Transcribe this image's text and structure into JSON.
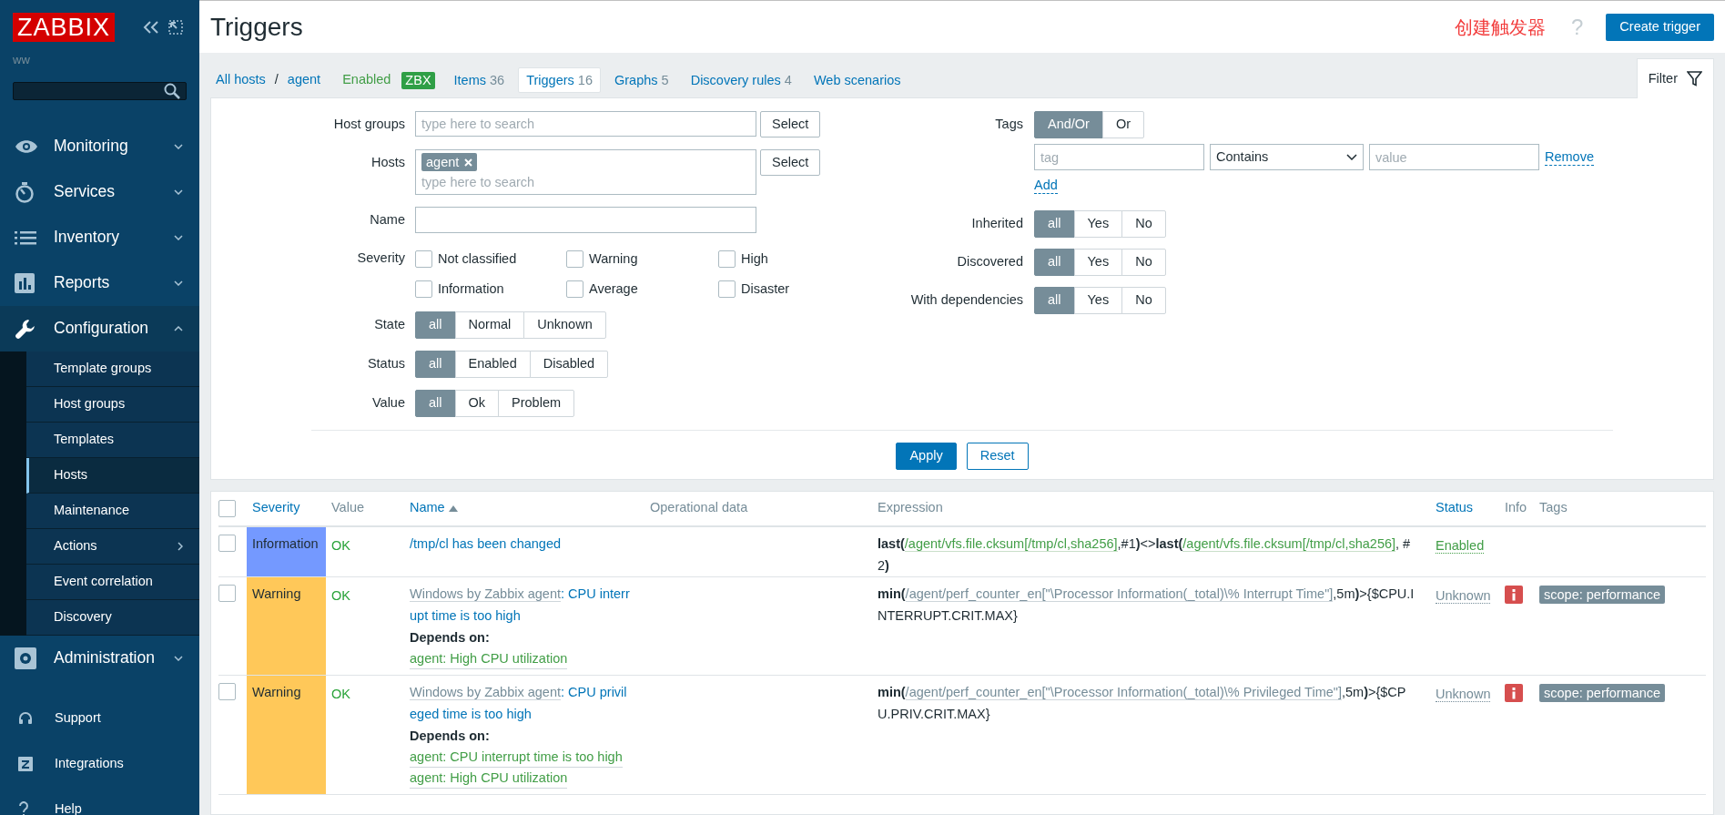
{
  "sidebar": {
    "logo": "ZABBIX",
    "user": "ww",
    "menu": [
      {
        "label": "Monitoring",
        "kind": "eye",
        "selected": false,
        "expanded": false
      },
      {
        "label": "Services",
        "kind": "timer",
        "selected": false,
        "expanded": false
      },
      {
        "label": "Inventory",
        "kind": "list",
        "selected": false,
        "expanded": false
      },
      {
        "label": "Reports",
        "kind": "chart",
        "selected": false,
        "expanded": false
      },
      {
        "label": "Configuration",
        "kind": "wrench",
        "selected": true,
        "expanded": true,
        "children": [
          {
            "label": "Template groups",
            "selected": false,
            "submenu": false
          },
          {
            "label": "Host groups",
            "selected": false,
            "submenu": false
          },
          {
            "label": "Templates",
            "selected": false,
            "submenu": false
          },
          {
            "label": "Hosts",
            "selected": true,
            "submenu": false
          },
          {
            "label": "Maintenance",
            "selected": false,
            "submenu": false
          },
          {
            "label": "Actions",
            "selected": false,
            "submenu": true
          },
          {
            "label": "Event correlation",
            "selected": false,
            "submenu": false
          },
          {
            "label": "Discovery",
            "selected": false,
            "submenu": false
          }
        ]
      },
      {
        "label": "Administration",
        "kind": "gear",
        "selected": false,
        "expanded": false
      }
    ],
    "footer": [
      {
        "label": "Support",
        "kind": "headset"
      },
      {
        "label": "Integrations",
        "kind": "z"
      },
      {
        "label": "Help",
        "kind": "question"
      }
    ]
  },
  "header": {
    "title": "Triggers",
    "annotation": "创建触发器",
    "help": "?",
    "create_button": "Create trigger"
  },
  "nav": {
    "breadcrumbs": [
      "All hosts",
      "agent"
    ],
    "separator": "/",
    "status": "Enabled",
    "badge": "ZBX",
    "tabs": [
      {
        "label": "Items",
        "count": "36",
        "selected": false
      },
      {
        "label": "Triggers",
        "count": "16",
        "selected": true
      },
      {
        "label": "Graphs",
        "count": "5",
        "selected": false
      },
      {
        "label": "Discovery rules",
        "count": "4",
        "selected": false
      },
      {
        "label": "Web scenarios",
        "selected": false
      }
    ],
    "filter_tab": "Filter"
  },
  "filter": {
    "left": [
      {
        "kind": "multiselect",
        "label": "Host groups",
        "placeholder": "type here to search",
        "button": "Select"
      },
      {
        "kind": "multiselect",
        "label": "Hosts",
        "chips": [
          "agent"
        ],
        "placeholder": "type here to search",
        "button": "Select"
      },
      {
        "kind": "text",
        "label": "Name"
      },
      {
        "kind": "checks",
        "label": "Severity",
        "options": [
          {
            "label": "Not classified",
            "checked": false
          },
          {
            "label": "Warning",
            "checked": false
          },
          {
            "label": "High",
            "checked": false
          },
          {
            "label": "Information",
            "checked": false
          },
          {
            "label": "Average",
            "checked": false
          },
          {
            "label": "Disaster",
            "checked": false
          }
        ]
      },
      {
        "kind": "segmented",
        "label": "State",
        "options": [
          {
            "label": "all",
            "selected": true
          },
          {
            "label": "Normal",
            "selected": false
          },
          {
            "label": "Unknown",
            "selected": false
          }
        ]
      },
      {
        "kind": "segmented",
        "label": "Status",
        "options": [
          {
            "label": "all",
            "selected": true
          },
          {
            "label": "Enabled",
            "selected": false
          },
          {
            "label": "Disabled",
            "selected": false
          }
        ]
      },
      {
        "kind": "segmented",
        "label": "Value",
        "options": [
          {
            "label": "all",
            "selected": true
          },
          {
            "label": "Ok",
            "selected": false
          },
          {
            "label": "Problem",
            "selected": false
          }
        ]
      }
    ],
    "tags": {
      "label": "Tags",
      "options": [
        {
          "label": "And/Or",
          "selected": true
        },
        {
          "label": "Or",
          "selected": false
        }
      ],
      "tag_placeholder": "tag",
      "operator": "Contains",
      "value_placeholder": "value",
      "remove": "Remove",
      "add": "Add"
    },
    "right": [
      {
        "label": "Inherited",
        "options": [
          {
            "label": "all",
            "selected": true
          },
          {
            "label": "Yes",
            "selected": false
          },
          {
            "label": "No",
            "selected": false
          }
        ]
      },
      {
        "label": "Discovered",
        "options": [
          {
            "label": "all",
            "selected": true
          },
          {
            "label": "Yes",
            "selected": false
          },
          {
            "label": "No",
            "selected": false
          }
        ]
      },
      {
        "label": "With dependencies",
        "options": [
          {
            "label": "all",
            "selected": true
          },
          {
            "label": "Yes",
            "selected": false
          },
          {
            "label": "No",
            "selected": false
          }
        ]
      }
    ],
    "apply": "Apply",
    "reset": "Reset"
  },
  "table": {
    "all_checked": false,
    "columns": [
      {
        "label": "Severity",
        "sortable": true,
        "sorted": false
      },
      {
        "label": "Value",
        "sortable": false,
        "sorted": false
      },
      {
        "label": "Name",
        "sortable": true,
        "sorted": true
      },
      {
        "label": "Operational data",
        "sortable": false,
        "sorted": false
      },
      {
        "label": "Expression",
        "sortable": false,
        "sorted": false
      },
      {
        "label": "Status",
        "sortable": true,
        "sorted": false
      },
      {
        "label": "Info",
        "sortable": false,
        "sorted": false
      },
      {
        "label": "Tags",
        "sortable": false,
        "sorted": false
      }
    ],
    "template_separator": ":",
    "rows": [
      {
        "checked": false,
        "severity": "Information",
        "color": "#7499ff",
        "value": "OK",
        "name": "/tmp/cl has been changed",
        "depends": [],
        "expression": [
          {
            "kind": "func",
            "text": "last("
          },
          {
            "kind": "item",
            "text": "/agent/vfs.file.cksum[/tmp/cl,sha256]",
            "active": true
          },
          {
            "kind": "text",
            "text": ",#1"
          },
          {
            "kind": "func",
            "text": ")"
          },
          {
            "kind": "text",
            "text": "<>"
          },
          {
            "kind": "func",
            "text": "last("
          },
          {
            "kind": "item",
            "text": "/agent/vfs.file.cksum[/tmp/cl,sha256]",
            "active": true
          },
          {
            "kind": "text",
            "text": ", #2"
          },
          {
            "kind": "func",
            "text": ")"
          }
        ],
        "status": "Enabled",
        "enabled": true,
        "error": false,
        "tags": []
      },
      {
        "checked": false,
        "severity": "Warning",
        "color": "#ffc859",
        "value": "OK",
        "template": "Windows by Zabbix agent",
        "name": "CPU interrupt time is too high",
        "depends_label": "Depends on:",
        "depends": [
          "agent: High CPU utilization"
        ],
        "expression": [
          {
            "kind": "func",
            "text": "min("
          },
          {
            "kind": "item",
            "text": "/agent/perf_counter_en[\"\\Processor Information(_total)\\% Interrupt Time\"]",
            "active": false
          },
          {
            "kind": "text",
            "text": ",5m"
          },
          {
            "kind": "func",
            "text": ")"
          },
          {
            "kind": "text",
            "text": ">{$CPU.INTERRUPT.CRIT.MAX}"
          }
        ],
        "status": "Unknown",
        "enabled": false,
        "error": true,
        "tags": [
          "scope: performance"
        ]
      },
      {
        "checked": false,
        "severity": "Warning",
        "color": "#ffc859",
        "value": "OK",
        "template": "Windows by Zabbix agent",
        "name": "CPU privileged time is too high",
        "depends_label": "Depends on:",
        "depends": [
          "agent: CPU interrupt time is too high",
          "agent: High CPU utilization"
        ],
        "expression": [
          {
            "kind": "func",
            "text": "min("
          },
          {
            "kind": "item",
            "text": "/agent/perf_counter_en[\"\\Processor Information(_total)\\% Privileged Time\"]",
            "active": false
          },
          {
            "kind": "text",
            "text": ",5m"
          },
          {
            "kind": "func",
            "text": ")"
          },
          {
            "kind": "text",
            "text": ">{$CPU.PRIV.CRIT.MAX}"
          }
        ],
        "status": "Unknown",
        "enabled": false,
        "error": true,
        "tags": [
          "scope: performance"
        ]
      }
    ]
  }
}
